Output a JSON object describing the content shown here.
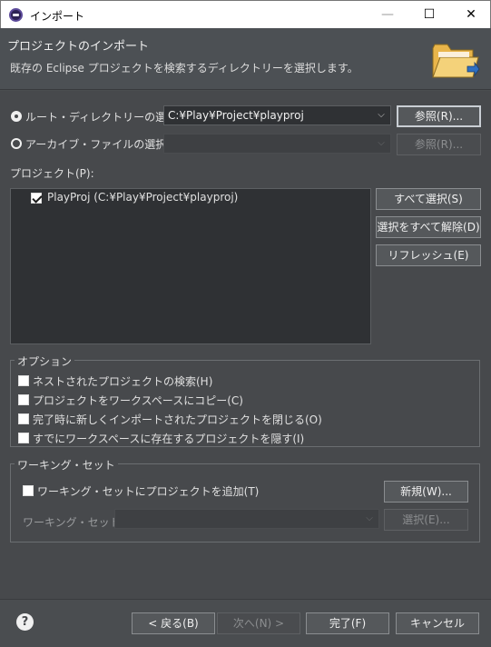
{
  "window": {
    "title": "インポート",
    "minimize": "—",
    "maximize": "☐",
    "close": "✕"
  },
  "header": {
    "title": "プロジェクトのインポート",
    "description": "既存の Eclipse プロジェクトを検索するディレクトリーを選択します。"
  },
  "root_dir": {
    "label": "ルート・ディレクトリーの選択(T):",
    "value": "C:¥Play¥Project¥playproj",
    "browse": "参照(R)...",
    "selected": true
  },
  "archive": {
    "label": "アーカイブ・ファイルの選択(A):",
    "value": "",
    "browse": "参照(R)...",
    "selected": false
  },
  "projects": {
    "label": "プロジェクト(P):",
    "items": [
      {
        "label": "PlayProj (C:¥Play¥Project¥playproj)",
        "checked": true
      }
    ],
    "select_all": "すべて選択(S)",
    "deselect_all": "選択をすべて解除(D)",
    "refresh": "リフレッシュ(E)"
  },
  "options": {
    "title": "オプション",
    "items": [
      {
        "label": "ネストされたプロジェクトの検索(H)",
        "checked": false
      },
      {
        "label": "プロジェクトをワークスペースにコピー(C)",
        "checked": false
      },
      {
        "label": "完了時に新しくインポートされたプロジェクトを閉じる(O)",
        "checked": false
      },
      {
        "label": "すでにワークスペースに存在するプロジェクトを隠す(I)",
        "checked": false
      }
    ]
  },
  "working_set": {
    "title": "ワーキング・セット",
    "add_label": "ワーキング・セットにプロジェクトを追加(T)",
    "add_checked": false,
    "new_button": "新規(W)...",
    "set_label": "ワーキング・セット(O):",
    "set_value": "",
    "select_button": "選択(E)..."
  },
  "footer": {
    "help": "?",
    "back": "< 戻る(B)",
    "next": "次へ(N) >",
    "finish": "完了(F)",
    "cancel": "キャンセル"
  }
}
